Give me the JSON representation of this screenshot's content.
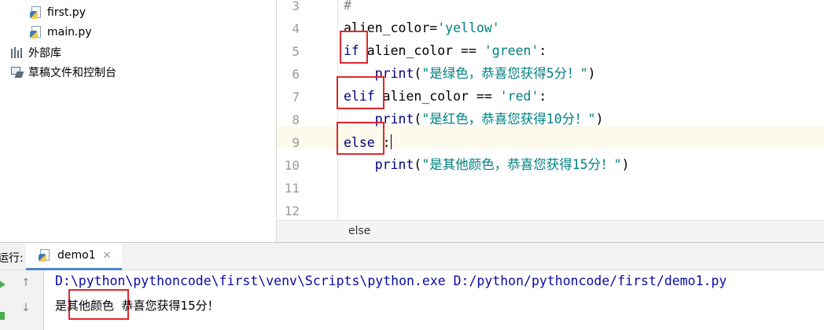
{
  "project_tree": {
    "items": [
      {
        "label": "first.py",
        "icon": "python-file-icon"
      },
      {
        "label": "main.py",
        "icon": "python-file-icon"
      },
      {
        "label": "外部库",
        "icon": "library-icon"
      },
      {
        "label": "草稿文件和控制台",
        "icon": "scratch-icon"
      }
    ]
  },
  "editor": {
    "line_numbers": [
      "3",
      "4",
      "5",
      "6",
      "7",
      "8",
      "9",
      "10",
      "11",
      "12"
    ],
    "lines": [
      {
        "text": "#"
      },
      {
        "tokens": [
          {
            "t": "alien_color=",
            "c": ""
          },
          {
            "t": "'yellow'",
            "c": "str"
          }
        ]
      },
      {
        "tokens": [
          {
            "t": "if",
            "c": "kw"
          },
          {
            "t": " alien_color == ",
            "c": ""
          },
          {
            "t": "'green'",
            "c": "str"
          },
          {
            "t": ":",
            "c": ""
          }
        ]
      },
      {
        "tokens": [
          {
            "t": "    ",
            "c": ""
          },
          {
            "t": "print",
            "c": "bi"
          },
          {
            "t": "(",
            "c": ""
          },
          {
            "t": "\"是绿色，恭喜您获得5分！\"",
            "c": "str"
          },
          {
            "t": ")",
            "c": ""
          }
        ]
      },
      {
        "tokens": [
          {
            "t": "elif",
            "c": "kw"
          },
          {
            "t": " alien_color == ",
            "c": ""
          },
          {
            "t": "'red'",
            "c": "str"
          },
          {
            "t": ":",
            "c": ""
          }
        ]
      },
      {
        "tokens": [
          {
            "t": "    ",
            "c": ""
          },
          {
            "t": "print",
            "c": "bi"
          },
          {
            "t": "(",
            "c": ""
          },
          {
            "t": "\"是红色，恭喜您获得10分！\"",
            "c": "str"
          },
          {
            "t": ")",
            "c": ""
          }
        ]
      },
      {
        "tokens": [
          {
            "t": "else",
            "c": "kw"
          },
          {
            "t": " :",
            "c": ""
          }
        ]
      },
      {
        "tokens": [
          {
            "t": "    ",
            "c": ""
          },
          {
            "t": "print",
            "c": "bi"
          },
          {
            "t": "(",
            "c": ""
          },
          {
            "t": "\"是其他颜色，恭喜您获得15分！\"",
            "c": "str"
          },
          {
            "t": ")",
            "c": ""
          }
        ]
      },
      {
        "tokens": []
      },
      {
        "tokens": []
      }
    ],
    "current_line": "9",
    "breadcrumb": "else"
  },
  "run_panel": {
    "label": "运行:",
    "tab_label": "demo1",
    "console": {
      "command": "D:\\python\\pythoncode\\first\\venv\\Scripts\\python.exe D:/python/pythoncode/first/demo1.py",
      "output": "是其他颜色  恭喜您获得15分！"
    }
  },
  "colors": {
    "annotation_box": "#e0262b",
    "keyword": "#000080",
    "string": "#008080",
    "console_command": "#0a0aa8",
    "current_line_bg": "#fcfaed"
  }
}
